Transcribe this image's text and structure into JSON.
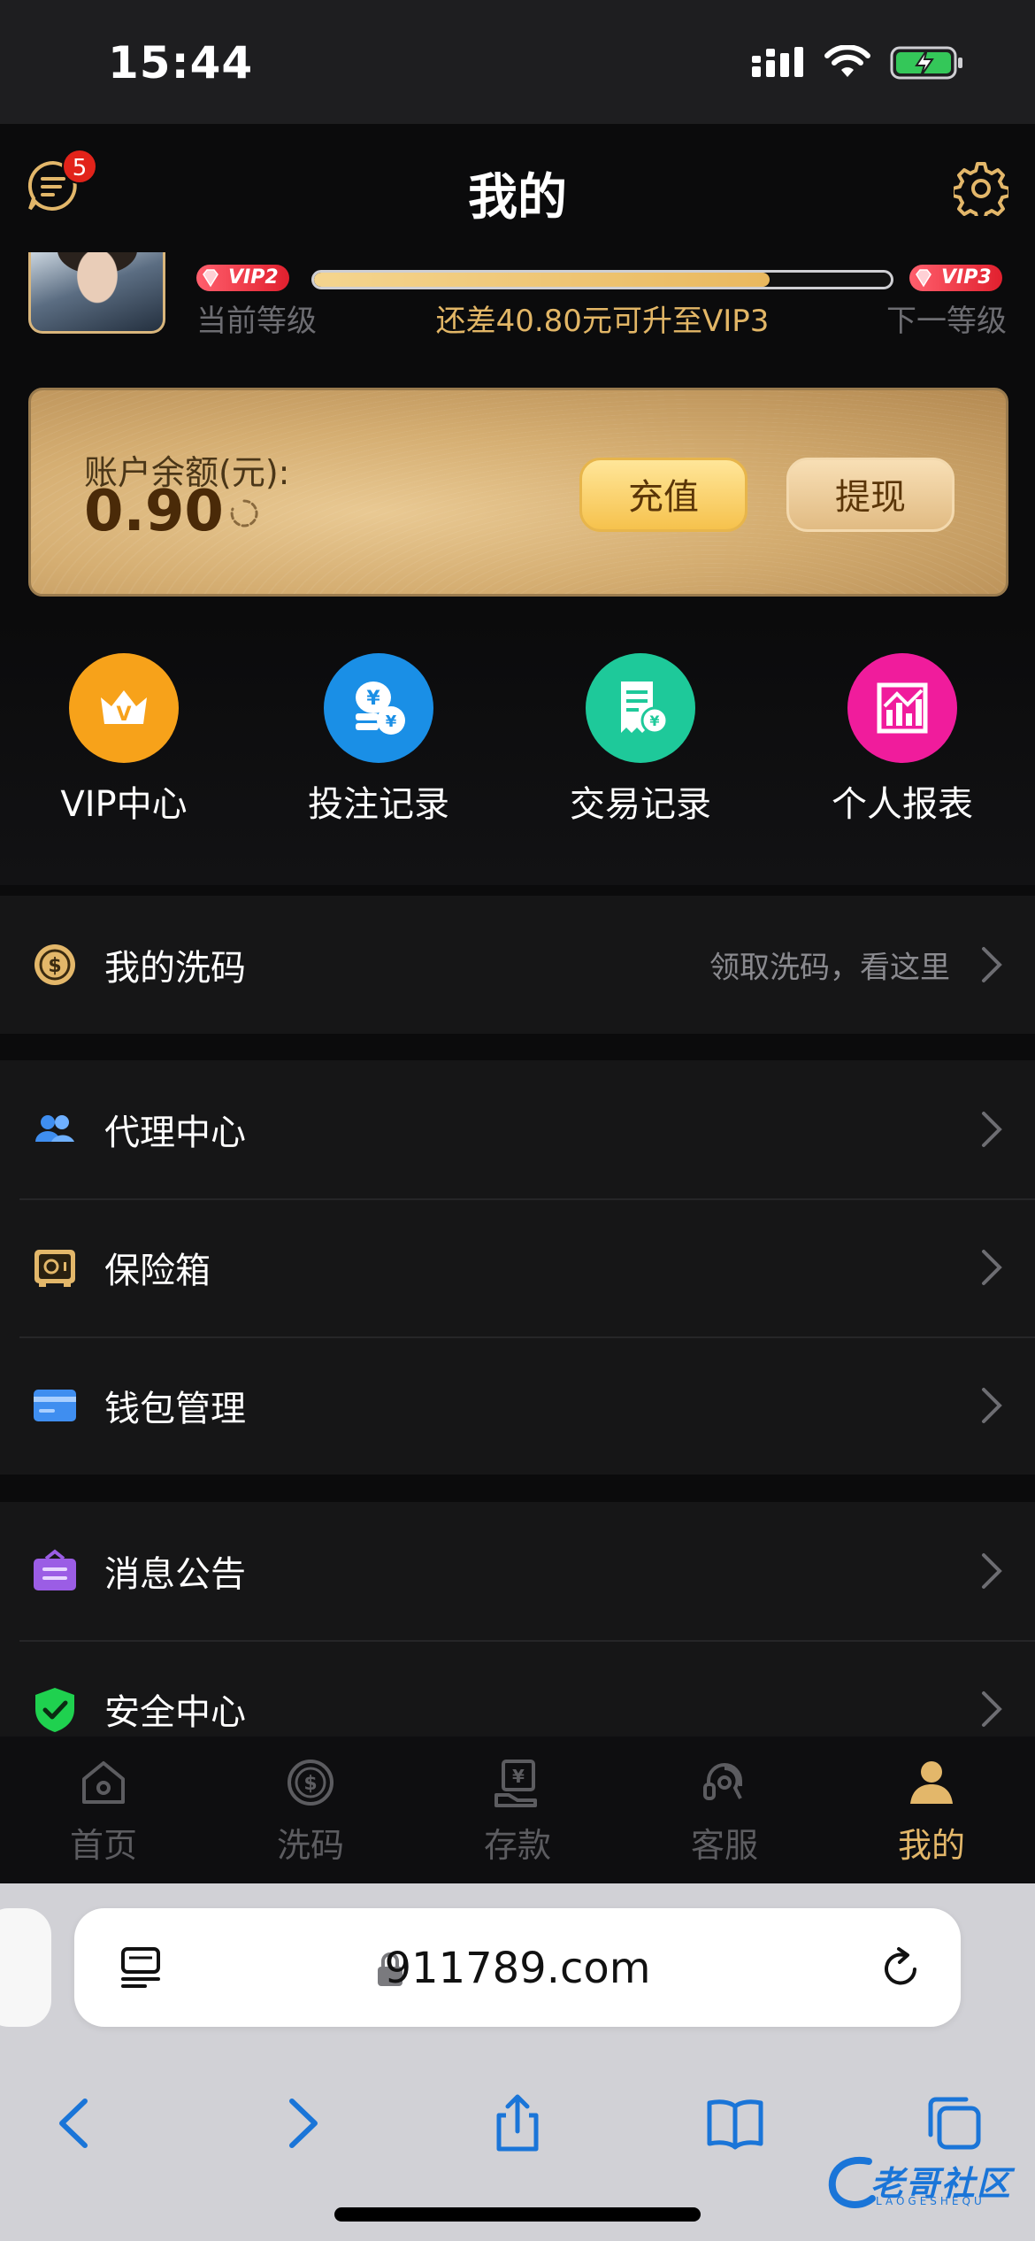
{
  "status_bar": {
    "time": "15:44"
  },
  "header": {
    "title": "我的",
    "message_badge": "5"
  },
  "profile": {
    "current_vip": "VIP2",
    "next_vip": "VIP3",
    "current_level_label": "当前等级",
    "next_level_label": "下一等级",
    "upgrade_text": "还差40.80元可升至VIP3",
    "progress": 0.79
  },
  "balance": {
    "label": "账户余额(元):",
    "value": "0.90",
    "recharge_label": "充值",
    "withdraw_label": "提现"
  },
  "shortcuts": [
    {
      "label": "VIP中心",
      "icon": "crown-icon",
      "color": "#f7a21a"
    },
    {
      "label": "投注记录",
      "icon": "coins-icon",
      "color": "#1a8fe6"
    },
    {
      "label": "交易记录",
      "icon": "receipt-icon",
      "color": "#1ec99a"
    },
    {
      "label": "个人报表",
      "icon": "chart-icon",
      "color": "#f01c9c"
    }
  ],
  "rebate_row": {
    "label": "我的洗码",
    "hint": "领取洗码，看这里"
  },
  "menu_group_1": [
    {
      "label": "代理中心",
      "icon": "agents-icon"
    },
    {
      "label": "保险箱",
      "icon": "safe-icon"
    },
    {
      "label": "钱包管理",
      "icon": "wallet-card-icon"
    }
  ],
  "menu_group_2": [
    {
      "label": "消息公告",
      "icon": "announcement-icon"
    },
    {
      "label": "安全中心",
      "icon": "shield-check-icon"
    }
  ],
  "tabbar": [
    {
      "label": "首页",
      "icon": "home-icon",
      "active": false
    },
    {
      "label": "洗码",
      "icon": "coin-dollar-icon",
      "active": false
    },
    {
      "label": "存款",
      "icon": "deposit-icon",
      "active": false
    },
    {
      "label": "客服",
      "icon": "headset-icon",
      "active": false
    },
    {
      "label": "我的",
      "icon": "user-icon",
      "active": true
    }
  ],
  "browser": {
    "url": "911789.com"
  },
  "watermark": {
    "text": "老哥社区",
    "sub": "LAOGESHEQU"
  },
  "colors": {
    "accent_gold": "#e3b76a",
    "background": "#0b0b0c",
    "row_bg": "#161617"
  }
}
